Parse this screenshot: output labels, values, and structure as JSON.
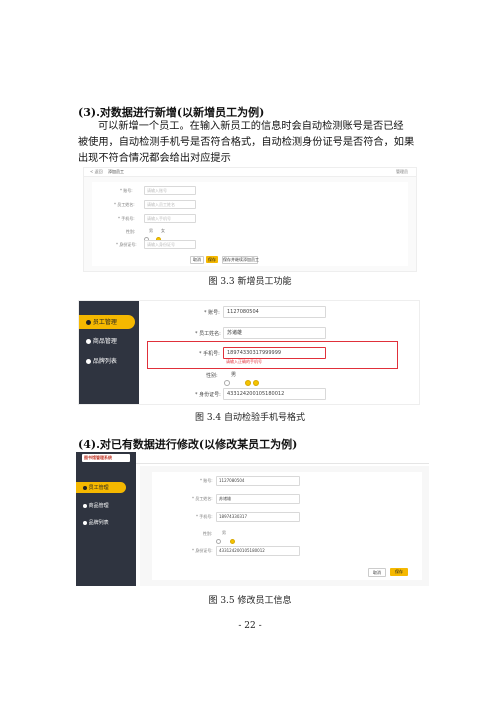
{
  "section3": {
    "heading": "(3).对数据进行新增(以新增员工为例)",
    "para": [
      "可以新增一个员工。在输入新员工的信息时会自动检测账号是否已经",
      "被使用，自动检测手机号是否符合格式，自动检测身份证号是否符合，如果",
      "出现不符合情况都会给出对应提示"
    ]
  },
  "fig33": {
    "caption": "图 3.3  新增员工功能",
    "topbar": {
      "back": "< 返回",
      "title": "添加员工",
      "user": "管理员"
    },
    "fields": [
      {
        "label": "* 账号:",
        "placeholder": "请输入账号"
      },
      {
        "label": "* 员工姓名:",
        "placeholder": "请输入员工姓名"
      },
      {
        "label": "* 手机号:",
        "placeholder": "请输入手机号"
      },
      {
        "label": "性别:",
        "radio1": "男",
        "radio2": "女"
      },
      {
        "label": "* 身份证号:",
        "placeholder": "请输入身份证号"
      }
    ],
    "buttons": {
      "cancel": "取消",
      "save": "保存",
      "save_continue": "保存并继续添加员工"
    }
  },
  "fig34": {
    "caption": "图 3.4  自动检验手机号格式",
    "nav": [
      "员工管理",
      "商品管理",
      "品牌列表"
    ],
    "fields": {
      "account_label": "* 账号:",
      "account_value": "1127080504",
      "name_label": "* 员工姓名:",
      "name_value": "苏诸雄",
      "phone_label": "* 手机号:",
      "phone_value": "18974330317999999",
      "phone_error": "请输入正确的手机号",
      "gender_label": "性别:",
      "gender_male": "男",
      "id_label": "* 身份证号:",
      "id_value": "433124200105180012"
    }
  },
  "section4": {
    "heading": "(4).对已有数据进行修改(以修改某员工为例)"
  },
  "fig35": {
    "caption": "图 3.5  修改员工信息",
    "logo": "图书馆管理系统",
    "nav": [
      "员工管理",
      "商品管理",
      "品牌列表"
    ],
    "fields": {
      "account_label": "* 账号:",
      "account_value": "1127080504",
      "name_label": "* 员工姓名:",
      "name_value": "苏诸雄",
      "phone_label": "* 手机号:",
      "phone_value": "18974330317",
      "gender_label": "性别:",
      "gender_male": "男",
      "id_label": "* 身份证号:",
      "id_value": "433124200105180012"
    },
    "buttons": {
      "cancel": "取消",
      "save": "保存"
    }
  },
  "page_number": "- 22 -",
  "colors": {
    "sidebar": "#2f3440",
    "accent": "#f5b800",
    "error": "#e0303a"
  }
}
